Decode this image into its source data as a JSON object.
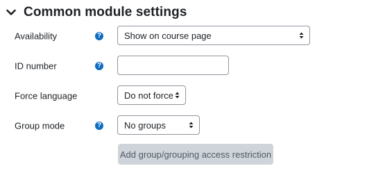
{
  "section": {
    "title": "Common module settings"
  },
  "fields": {
    "availability": {
      "label": "Availability",
      "help": "?",
      "value": "Show on course page"
    },
    "id_number": {
      "label": "ID number",
      "help": "?",
      "value": "",
      "placeholder": ""
    },
    "force_language": {
      "label": "Force language",
      "value": "Do not force"
    },
    "group_mode": {
      "label": "Group mode",
      "help": "?",
      "value": "No groups"
    }
  },
  "actions": {
    "add_restriction": "Add group/grouping access restriction"
  },
  "colors": {
    "help_icon": "#0f6cbf",
    "disabled_button_bg": "#ced4da"
  }
}
